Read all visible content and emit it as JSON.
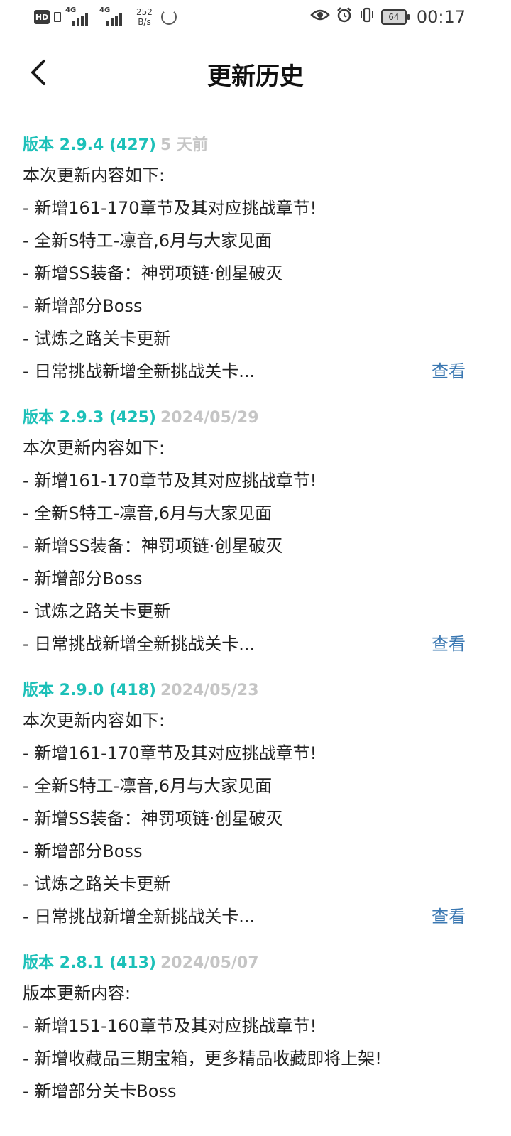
{
  "status_bar": {
    "hd": "HD",
    "sim1_gen": "4G",
    "sim2_gen": "4G",
    "net_speed_value": "252",
    "net_speed_unit": "B/s",
    "battery": "64",
    "time": "00:17",
    "icons": [
      "eye-icon",
      "alarm-icon",
      "vibrate-icon",
      "battery-icon"
    ]
  },
  "header": {
    "title": "更新历史",
    "back_icon": "chevron-left-icon"
  },
  "entries": [
    {
      "version": "版本 2.9.4 (427)",
      "date": "5 天前",
      "intro": "本次更新内容如下:",
      "items": [
        "- 新增161-170章节及其对应挑战章节!",
        "- 全新S特工-凛音,6月与大家见面",
        "- 新增SS装备：神罚项链·创星破灭",
        "- 新增部分Boss",
        "- 试炼之路关卡更新",
        "- 日常挑战新增全新挑战关卡..."
      ],
      "view_label": "查看"
    },
    {
      "version": "版本 2.9.3 (425)",
      "date": "2024/05/29",
      "intro": "本次更新内容如下:",
      "items": [
        "- 新增161-170章节及其对应挑战章节!",
        "- 全新S特工-凛音,6月与大家见面",
        "- 新增SS装备：神罚项链·创星破灭",
        "- 新增部分Boss",
        "- 试炼之路关卡更新",
        "- 日常挑战新增全新挑战关卡..."
      ],
      "view_label": "查看"
    },
    {
      "version": "版本 2.9.0 (418)",
      "date": "2024/05/23",
      "intro": "本次更新内容如下:",
      "items": [
        "- 新增161-170章节及其对应挑战章节!",
        "- 全新S特工-凛音,6月与大家见面",
        "- 新增SS装备：神罚项链·创星破灭",
        "- 新增部分Boss",
        "- 试炼之路关卡更新",
        "- 日常挑战新增全新挑战关卡..."
      ],
      "view_label": "查看"
    },
    {
      "version": "版本 2.8.1 (413)",
      "date": "2024/05/07",
      "intro": "版本更新内容:",
      "items": [
        "- 新增151-160章节及其对应挑战章节!",
        "- 新增收藏品三期宝箱，更多精品收藏即将上架!",
        "- 新增部分关卡Boss"
      ],
      "view_label": ""
    }
  ]
}
